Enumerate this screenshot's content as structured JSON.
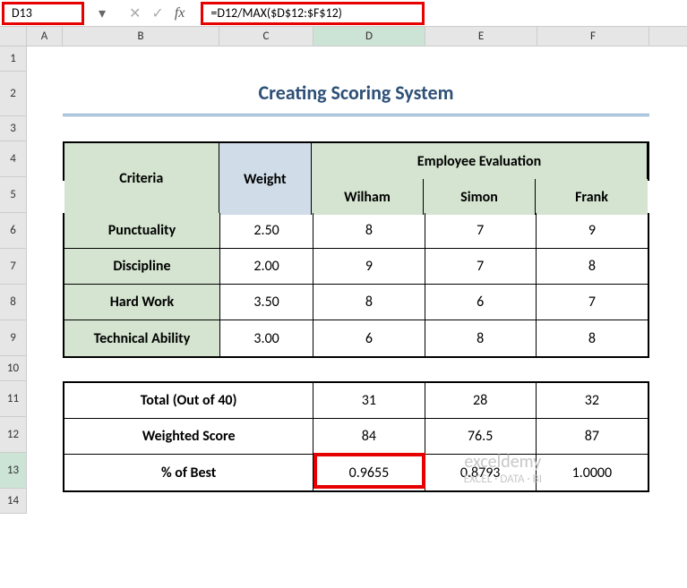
{
  "nameBox": "D13",
  "formula": "=D12/MAX($D$12:$F$12)",
  "columns": [
    "A",
    "B",
    "C",
    "D",
    "E",
    "F"
  ],
  "rows": [
    "1",
    "2",
    "3",
    "4",
    "5",
    "6",
    "7",
    "8",
    "9",
    "10",
    "11",
    "12",
    "13",
    "14"
  ],
  "title": "Creating Scoring System",
  "headers": {
    "criteria": "Criteria",
    "weight": "Weight",
    "evalHeader": "Employee Evaluation",
    "emp1": "Wilham",
    "emp2": "Simon",
    "emp3": "Frank"
  },
  "criteria": [
    {
      "name": "Punctuality",
      "weight": "2.50",
      "e1": "8",
      "e2": "7",
      "e3": "9"
    },
    {
      "name": "Discipline",
      "weight": "2.00",
      "e1": "9",
      "e2": "7",
      "e3": "8"
    },
    {
      "name": "Hard Work",
      "weight": "3.50",
      "e1": "8",
      "e2": "6",
      "e3": "7"
    },
    {
      "name": "Technical Ability",
      "weight": "3.00",
      "e1": "6",
      "e2": "8",
      "e3": "8"
    }
  ],
  "summary": {
    "totalLabel": "Total (Out of 40)",
    "weightedLabel": "Weighted Score",
    "pctLabel": "% of Best",
    "total": {
      "e1": "31",
      "e2": "28",
      "e3": "32"
    },
    "weighted": {
      "e1": "84",
      "e2": "76.5",
      "e3": "87"
    },
    "pct": {
      "e1": "0.9655",
      "e2": "0.8793",
      "e3": "1.0000"
    }
  },
  "watermark": {
    "line1": "exceldemy",
    "line2": "EXCEL · DATA · BI"
  }
}
